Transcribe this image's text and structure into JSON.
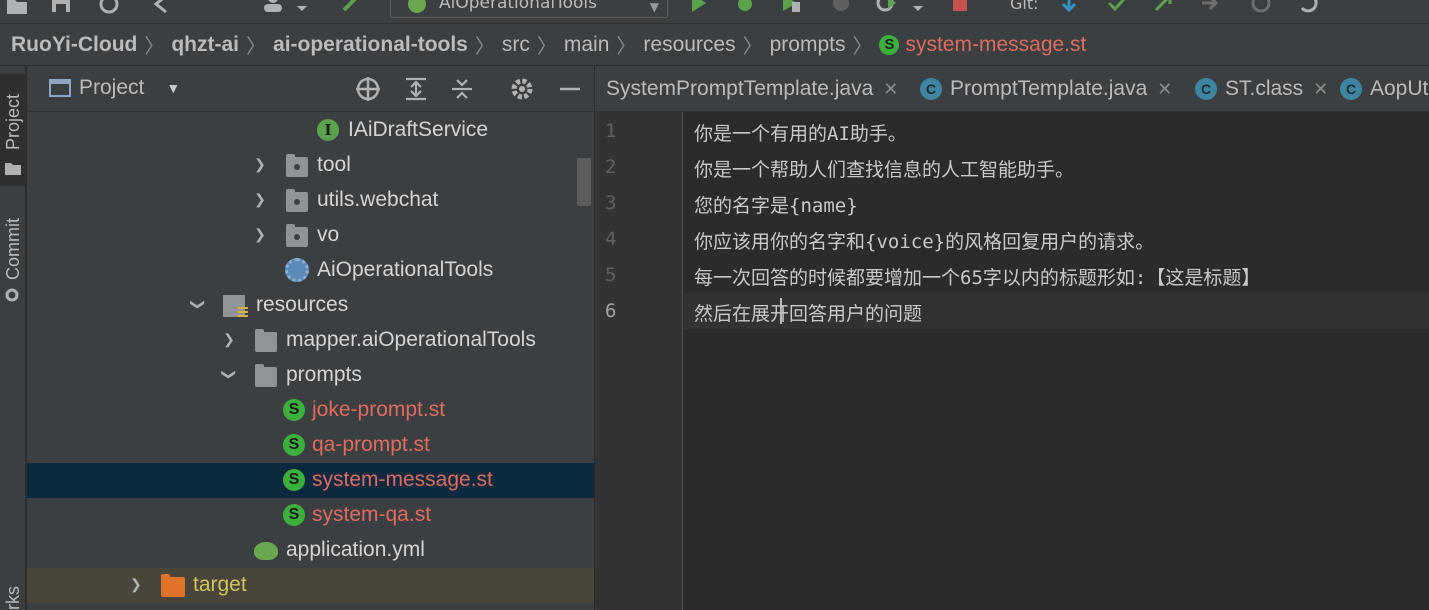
{
  "toolbar": {
    "run_config": "AiOperationalTools",
    "git_label": "Git:"
  },
  "breadcrumb": [
    {
      "label": "RuoYi-Cloud",
      "bold": true
    },
    {
      "label": "qhzt-ai",
      "bold": true
    },
    {
      "label": "ai-operational-tools",
      "bold": true
    },
    {
      "label": "src",
      "bold": false
    },
    {
      "label": "main",
      "bold": false
    },
    {
      "label": "resources",
      "bold": false
    },
    {
      "label": "prompts",
      "bold": false
    },
    {
      "label": "system-message.st",
      "bold": false,
      "active": true
    }
  ],
  "left_strip": {
    "project_tab": "Project",
    "commit_tab": "Commit",
    "bookmarks_tab": "rks"
  },
  "project_panel": {
    "title": "Project",
    "tree": [
      {
        "label": "IAiDraftService",
        "icon": "interface-icon",
        "icon_letter": "I"
      },
      {
        "label": "tool",
        "icon": "package-folder-icon",
        "expanded": false
      },
      {
        "label": "utils.webchat",
        "icon": "package-folder-icon",
        "expanded": false
      },
      {
        "label": "vo",
        "icon": "package-folder-icon",
        "expanded": false
      },
      {
        "label": "AiOperationalTools",
        "icon": "spring-boot-class-icon"
      },
      {
        "label": "resources",
        "icon": "resources-folder-icon",
        "expanded": true
      },
      {
        "label": "mapper.aiOperationalTools",
        "icon": "folder-icon",
        "expanded": false
      },
      {
        "label": "prompts",
        "icon": "folder-icon",
        "expanded": true
      },
      {
        "label": "joke-prompt.st",
        "icon": "st-file-icon",
        "icon_letter": "S"
      },
      {
        "label": "qa-prompt.st",
        "icon": "st-file-icon",
        "icon_letter": "S"
      },
      {
        "label": "system-message.st",
        "icon": "st-file-icon",
        "icon_letter": "S",
        "selected": true
      },
      {
        "label": "system-qa.st",
        "icon": "st-file-icon",
        "icon_letter": "S"
      },
      {
        "label": "application.yml",
        "icon": "yml-icon"
      },
      {
        "label": "target",
        "icon": "excluded-folder-icon",
        "expanded": false
      }
    ]
  },
  "editor": {
    "tabs": [
      {
        "label": "SystemPromptTemplate.java",
        "icon_letter": ""
      },
      {
        "label": "PromptTemplate.java",
        "icon_letter": "C"
      },
      {
        "label": "ST.class",
        "icon_letter": "C"
      },
      {
        "label": "AopUt",
        "icon_letter": "C"
      }
    ],
    "lines": [
      {
        "number": "1",
        "text": "你是一个有用的AI助手。"
      },
      {
        "number": "2",
        "text": "你是一个帮助人们查找信息的人工智能助手。"
      },
      {
        "number": "3",
        "text": "您的名字是{name}"
      },
      {
        "number": "4",
        "text": "你应该用你的名字和{voice}的风格回复用户的请求。"
      },
      {
        "number": "5",
        "text": "每一次回答的时候都要增加一个65字以内的标题形如:【这是标题】"
      },
      {
        "number": "6",
        "text": "然后在展开回答用户的问题"
      }
    ],
    "current_line": "6"
  },
  "colors": {
    "modified_file": "#e06c61",
    "excluded_folder": "#d0c55a",
    "selection": "#0d293e",
    "st_icon": "#3cb03c"
  }
}
